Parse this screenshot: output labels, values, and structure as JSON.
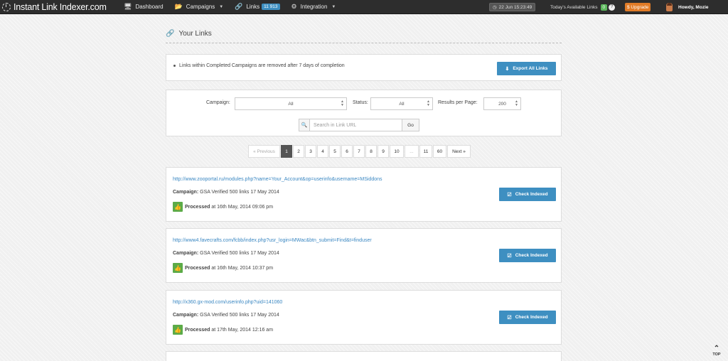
{
  "nav": {
    "brand": "Instant Link Indexer.com",
    "items": [
      {
        "label": "Dashboard",
        "icon": "monitor-icon"
      },
      {
        "label": "Campaigns",
        "icon": "folder-icon"
      },
      {
        "label": "Links",
        "icon": "link-icon",
        "badge": "11 913"
      },
      {
        "label": "Integration",
        "icon": "gears-icon"
      }
    ],
    "clock": "22 Jun 15:23:49",
    "available_label": "Today's Available Links",
    "available_count": "0",
    "help": "?",
    "upgrade": "$ Upgrade",
    "user": "Howdy, Mozie"
  },
  "page": {
    "title": "Your Links",
    "notice": "Links within Completed Campaigns are removed after 7 days of completion",
    "export_label": "Export All Links"
  },
  "filters": {
    "campaign_label": "Campaign:",
    "campaign_value": "All",
    "status_label": "Status:",
    "status_value": "All",
    "rpp_label": "Results per Page:",
    "rpp_value": "200",
    "search_placeholder": "Search in Link URL",
    "go_label": "Go"
  },
  "pagination": [
    "« Previous",
    "1",
    "2",
    "3",
    "4",
    "5",
    "6",
    "7",
    "8",
    "9",
    "10",
    "...",
    "11",
    "60",
    "Next »"
  ],
  "links": [
    {
      "url": "http://www.zooportal.ru/modules.php?name=Your_Account&op=userinfo&username=MSiddons",
      "campaign_label": "Campaign:",
      "campaign": "GSA Verified 500 links 17 May 2014",
      "status": "Processed",
      "processed_at": "at 16th May, 2014 09:06 pm",
      "button": "Check Indexed"
    },
    {
      "url": "http://www4.favecrafts.com/fcbb/index.php?usr_login=MWac&btn_submit=Find&t=finduser",
      "campaign_label": "Campaign:",
      "campaign": "GSA Verified 500 links 17 May 2014",
      "status": "Processed",
      "processed_at": "at 16th May, 2014 10:37 pm",
      "button": "Check Indexed"
    },
    {
      "url": "http://x360.gx-mod.com/userinfo.php?uid=141060",
      "campaign_label": "Campaign:",
      "campaign": "GSA Verified 500 links 17 May 2014",
      "status": "Processed",
      "processed_at": "at 17th May, 2014 12:16 am",
      "button": "Check Indexed"
    }
  ],
  "top_label": "TOP",
  "colors": {
    "accent": "#3e8fc1",
    "success": "#5cab48",
    "navbar": "#2d2d2d",
    "upgrade": "#e07b27"
  }
}
